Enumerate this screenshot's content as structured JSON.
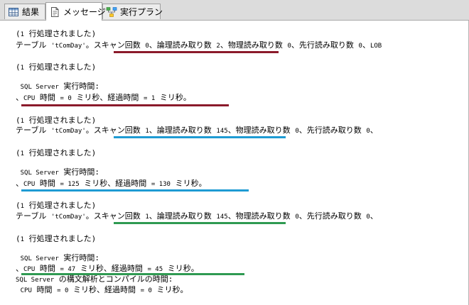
{
  "tabs": [
    {
      "label": "結果",
      "icon": "grid-icon"
    },
    {
      "label": "メッセージ",
      "icon": "document-icon"
    },
    {
      "label": "実行プラン",
      "icon": "execution-plan-icon"
    }
  ],
  "colors": {
    "underline_1": "#8b1a2b",
    "underline_2": "#1e9bd3",
    "underline_3": "#2f9a52"
  },
  "messages": [
    {
      "pre": "(",
      "c": "1",
      "post": " 行処理されました)"
    },
    {
      "pre": "テーブル ",
      "c": "'tComDay'",
      "post": "。スキャン回数 ",
      "c2": "0",
      "post2": "、論理読み取り数 ",
      "c3": "2",
      "post3": "、物理読み取り数 ",
      "c4": "0",
      "post4": "、先行読み取り数 ",
      "c5": "0",
      "post5": "、",
      "c6": "LOB"
    },
    {
      "pre": "(",
      "c": "1",
      "post": " 行処理されました)"
    },
    {
      "pre": " ",
      "c": "SQL Server",
      "post": " 実行時間:"
    },
    {
      "pre": "、",
      "c": "CPU",
      "post": " 時間 ",
      "c2": "= 0",
      "post2": " ミリ秒、経過時間 ",
      "c3": "= 1",
      "post3": " ミリ秒。"
    },
    {
      "pre": "(",
      "c": "1",
      "post": " 行処理されました)"
    },
    {
      "pre": "テーブル ",
      "c": "'tComDay'",
      "post": "。スキャン回数 ",
      "c2": "1",
      "post2": "、論理読み取り数 ",
      "c3": "145",
      "post3": "、物理読み取り数 ",
      "c4": "0",
      "post4": "、先行読み取り数 ",
      "c5": "0",
      "post5": "、"
    },
    {
      "pre": "(",
      "c": "1",
      "post": " 行処理されました)"
    },
    {
      "pre": " ",
      "c": "SQL Server",
      "post": " 実行時間:"
    },
    {
      "pre": "、",
      "c": "CPU",
      "post": " 時間 ",
      "c2": "= 125",
      "post2": " ミリ秒、経過時間 ",
      "c3": "= 130",
      "post3": " ミリ秒。"
    },
    {
      "pre": "(",
      "c": "1",
      "post": " 行処理されました)"
    },
    {
      "pre": "テーブル ",
      "c": "'tComDay'",
      "post": "。スキャン回数 ",
      "c2": "1",
      "post2": "、論理読み取り数 ",
      "c3": "145",
      "post3": "、物理読み取り数 ",
      "c4": "0",
      "post4": "、先行読み取り数 ",
      "c5": "0",
      "post5": "、"
    },
    {
      "pre": "(",
      "c": "1",
      "post": " 行処理されました)"
    },
    {
      "pre": " ",
      "c": "SQL Server",
      "post": " 実行時間:"
    },
    {
      "pre": "、",
      "c": "CPU",
      "post": " 時間 ",
      "c2": "= 47",
      "post2": " ミリ秒、経過時間 ",
      "c3": "= 45",
      "post3": " ミリ秒。"
    },
    {
      "pre": "",
      "c": "SQL Server",
      "post": " の構文解析とコンパイルの時間:"
    },
    {
      "pre": " ",
      "c": "CPU",
      "post": " 時間 ",
      "c2": "= 0",
      "post2": " ミリ秒、経過時間 ",
      "c3": "= 0",
      "post3": " ミリ秒。"
    }
  ]
}
